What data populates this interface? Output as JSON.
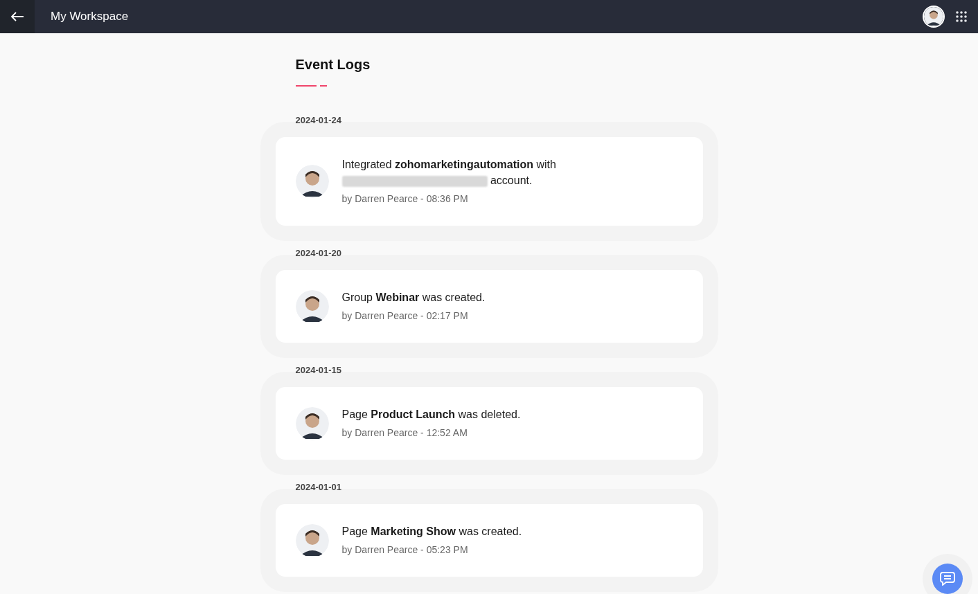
{
  "header": {
    "title": "My Workspace"
  },
  "page": {
    "title": "Event Logs"
  },
  "events": [
    {
      "date": "2024-01-24",
      "message": "Integrated **zohomarketingautomation** with",
      "redacted": true,
      "message_end": "account.",
      "meta": "by Darren Pearce - 08:36 PM"
    },
    {
      "date": "2024-01-20",
      "message": "Group **Webinar** was created.",
      "redacted": false,
      "meta": "by Darren Pearce - 02:17 PM"
    },
    {
      "date": "2024-01-15",
      "message": "Page **Product Launch** was deleted.",
      "redacted": false,
      "meta": "by Darren Pearce - 12:52 AM"
    },
    {
      "date": "2024-01-01",
      "message": "Page **Marketing Show** was created.",
      "redacted": false,
      "meta": "by Darren Pearce - 05:23 PM"
    }
  ]
}
